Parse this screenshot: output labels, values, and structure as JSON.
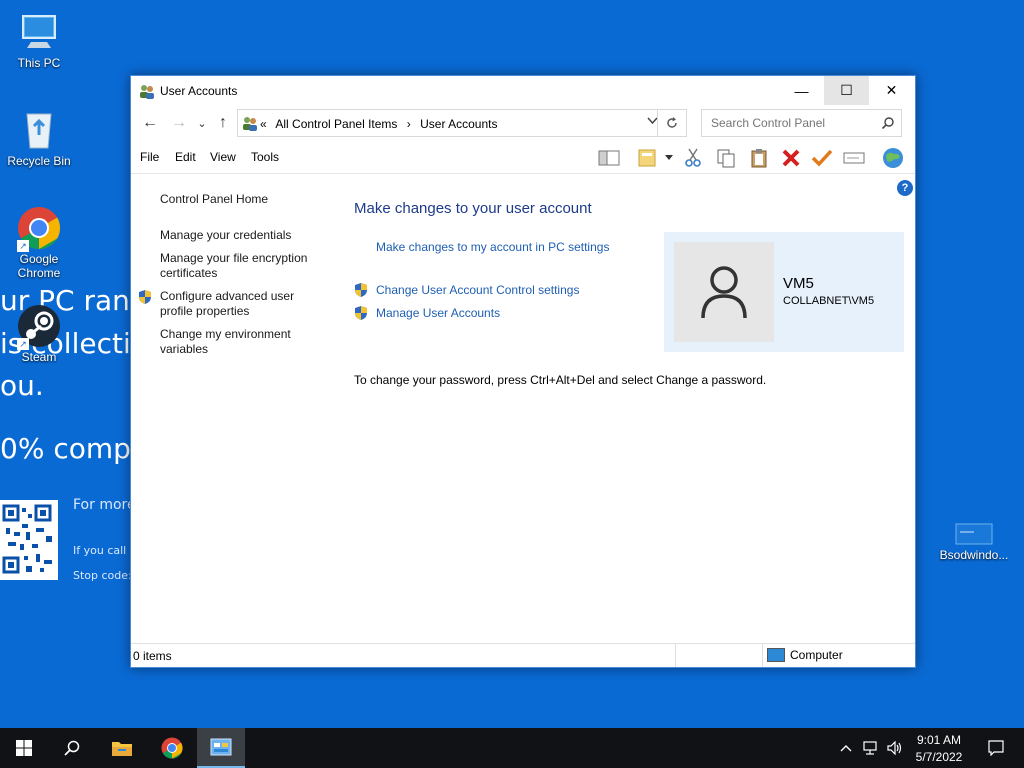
{
  "background": {
    "line1": "ur PC ran",
    "line2": "is collectin",
    "line3": "ou.",
    "line4": "0% comple",
    "for_more": "For more",
    "if_you_call": "If you call a",
    "stop_code": "Stop code: "
  },
  "desktop_icons": [
    {
      "label": "This PC",
      "icon": "computer-icon"
    },
    {
      "label": "Recycle Bin",
      "icon": "recycle-bin-icon"
    },
    {
      "label": "Google Chrome",
      "icon": "chrome-icon"
    },
    {
      "label": "Steam",
      "icon": "steam-icon"
    },
    {
      "label": "Bsodwindo...",
      "icon": "file-icon"
    }
  ],
  "window": {
    "title": "User Accounts",
    "minimize": "—",
    "maximize": "☐",
    "close": "✕"
  },
  "nav": {
    "back": "←",
    "forward": "→",
    "recent": "⌄",
    "up": "↑",
    "chevrons": "«",
    "breadcrumbs": [
      "All Control Panel Items",
      "User Accounts"
    ],
    "separator": "›",
    "search_placeholder": "Search Control Panel"
  },
  "menu": [
    "File",
    "Edit",
    "View",
    "Tools"
  ],
  "left_pane": {
    "home": "Control Panel Home",
    "links": [
      "Manage your credentials",
      "Manage your file encryption certificates",
      "Configure advanced user profile properties",
      "Change my environment variables"
    ]
  },
  "main": {
    "title": "Make changes to your user account",
    "link_pc_settings": "Make changes to my account in PC settings",
    "link_uac": "Change User Account Control settings",
    "link_manage": "Manage User Accounts",
    "password_hint": "To change your password, press Ctrl+Alt+Del and select Change a password."
  },
  "user": {
    "name": "VM5",
    "domain": "COLLABNET\\VM5"
  },
  "status": {
    "items": "0 items",
    "location": "Computer"
  },
  "taskbar": {
    "time": "9:01 AM",
    "date": "5/7/2022"
  },
  "colors": {
    "desktop": "#0a6ad4",
    "link": "#1f5fb4",
    "title": "#1e3a8a",
    "user_card": "#e6f1fb"
  }
}
